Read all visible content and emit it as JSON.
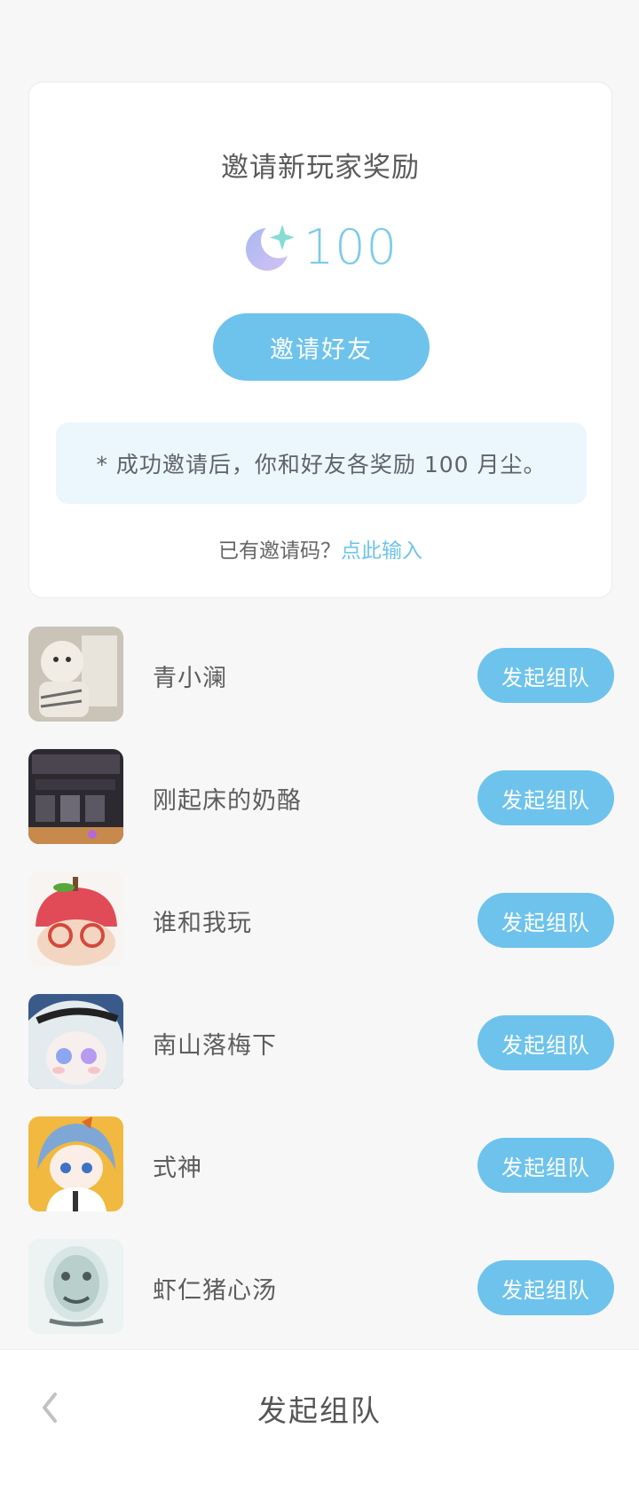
{
  "invite": {
    "title": "邀请新玩家奖励",
    "reward_icon": "moon-star-icon",
    "reward_amount": "100",
    "button_label": "邀请好友",
    "notice": "* 成功邀请后，你和好友各奖励 100 月尘。",
    "code_question": "已有邀请码？",
    "code_link": "点此输入"
  },
  "friends": [
    {
      "name": "青小澜",
      "button": "发起组队"
    },
    {
      "name": "刚起床的奶酪",
      "button": "发起组队"
    },
    {
      "name": "谁和我玩",
      "button": "发起组队"
    },
    {
      "name": "南山落梅下",
      "button": "发起组队"
    },
    {
      "name": "式神",
      "button": "发起组队"
    },
    {
      "name": "虾仁猪心汤",
      "button": "发起组队"
    }
  ],
  "bottom_bar": {
    "back_icon": "chevron-left-icon",
    "title": "发起组队"
  },
  "colors": {
    "accent": "#6ec3ec",
    "notice_bg": "#ecf7fd",
    "page_bg": "#f7f7f8"
  }
}
